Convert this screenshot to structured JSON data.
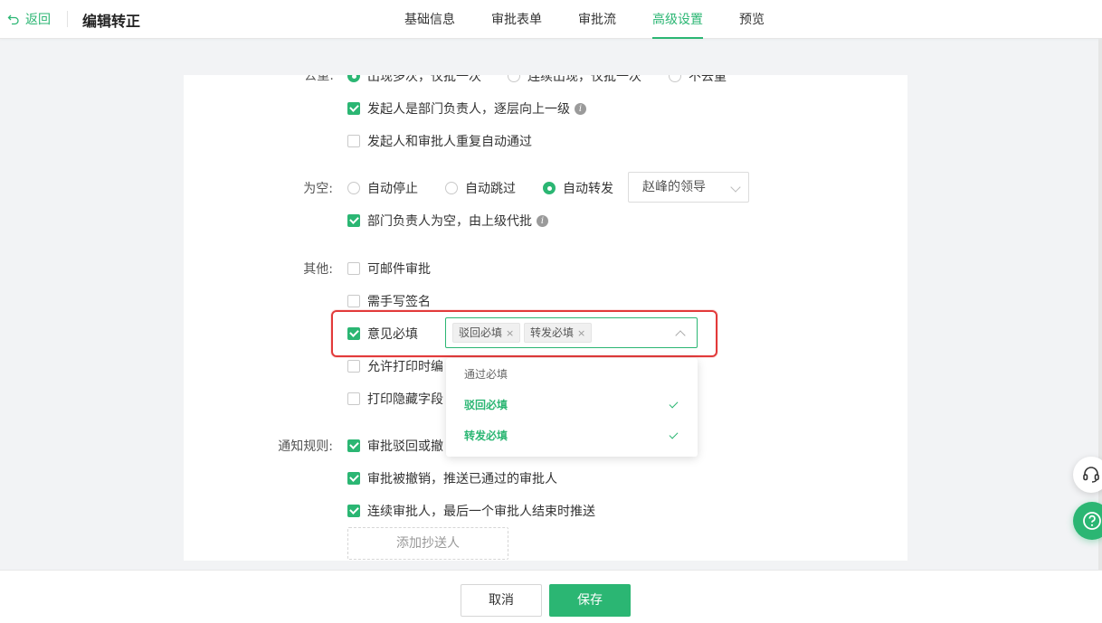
{
  "header": {
    "back_label": "返回",
    "title": "编辑转正",
    "tabs": [
      {
        "label": "基础信息",
        "active": false
      },
      {
        "label": "审批表单",
        "active": false
      },
      {
        "label": "审批流",
        "active": false
      },
      {
        "label": "高级设置",
        "active": true
      },
      {
        "label": "预览",
        "active": false
      }
    ]
  },
  "dedupe": {
    "label": "去重:",
    "options": [
      {
        "label": "出现多次，仅批一次",
        "selected": true
      },
      {
        "label": "连续出现，仅批一次",
        "selected": false
      },
      {
        "label": "不去重",
        "selected": false
      }
    ],
    "checks": [
      {
        "label": "发起人是部门负责人，逐层向上一级",
        "checked": true,
        "info": true
      },
      {
        "label": "发起人和审批人重复自动通过",
        "checked": false,
        "info": false
      }
    ]
  },
  "empty": {
    "label": "为空:",
    "options": [
      {
        "label": "自动停止",
        "selected": false
      },
      {
        "label": "自动跳过",
        "selected": false
      },
      {
        "label": "自动转发",
        "selected": true
      }
    ],
    "forward_select": "赵峰的领导",
    "checks": [
      {
        "label": "部门负责人为空，由上级代批",
        "checked": true,
        "info": true
      }
    ]
  },
  "other": {
    "label": "其他:",
    "items": [
      {
        "label": "可邮件审批",
        "checked": false
      },
      {
        "label": "需手写签名",
        "checked": false
      },
      {
        "label": "意见必填",
        "checked": true
      },
      {
        "label": "允许打印时编",
        "checked": false
      },
      {
        "label": "打印隐藏字段",
        "checked": false
      }
    ],
    "opinion_tags": [
      "驳回必填",
      "转发必填"
    ],
    "dropdown": [
      {
        "label": "通过必填",
        "selected": false
      },
      {
        "label": "驳回必填",
        "selected": true
      },
      {
        "label": "转发必填",
        "selected": true
      }
    ]
  },
  "notify": {
    "label": "通知规则:",
    "items": [
      {
        "label": "审批驳回或撤",
        "checked": true
      },
      {
        "label": "审批被撤销，推送已通过的审批人",
        "checked": true
      },
      {
        "label": "连续审批人，最后一个审批人结束时推送",
        "checked": true
      }
    ],
    "add_cc": "添加抄送人"
  },
  "footer": {
    "cancel": "取消",
    "save": "保存"
  },
  "colors": {
    "accent": "#2bb673",
    "highlight": "#e23a3a"
  }
}
